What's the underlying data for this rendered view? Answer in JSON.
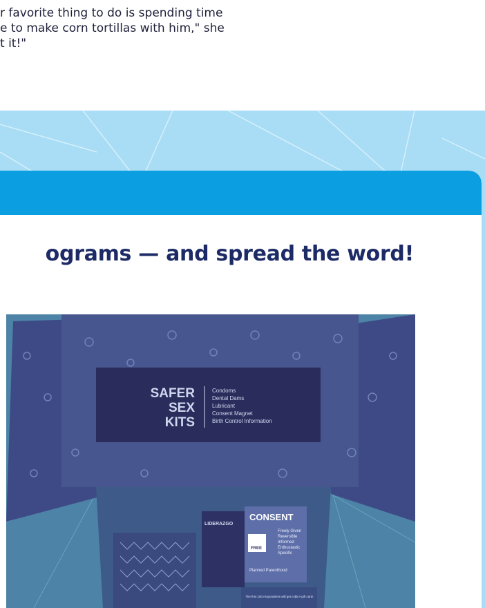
{
  "quote": {
    "text": "r favorite thing to do is spending time\ne to make corn tortillas with him,\" she\nt it!\""
  },
  "card": {
    "heading": "ograms — and spread the word!"
  },
  "photo": {
    "kit_title": [
      "SAFER",
      "SEX",
      "KITS"
    ],
    "kit_items": [
      "Condoms",
      "Dental Dams",
      "Lubricant",
      "Consent Magnet",
      "Birth Control Information"
    ],
    "lider_brand": "LIDERAZGO",
    "consent_title": "CONSENT",
    "consent_items": [
      "Freely Given",
      "Reversible",
      "Informed",
      "Enthusiastic",
      "Specific"
    ],
    "planned_parenthood": "Planned Parenthood",
    "free_label": "FREE",
    "notice": "The first 150 respondents will get a $5 e-gift card!"
  },
  "colors": {
    "band": "#a9dcf5",
    "header": "#0b9ee0",
    "heading_text": "#1c2a66"
  }
}
